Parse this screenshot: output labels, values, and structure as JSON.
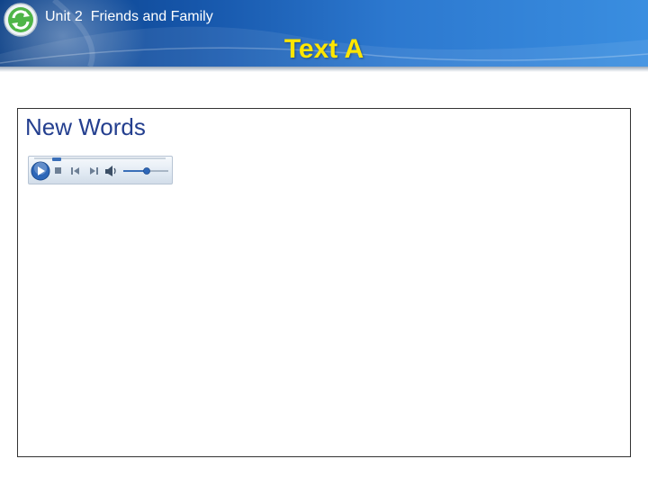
{
  "header": {
    "unit_title": "Unit 2  Friends and Family",
    "page_title": "Text A",
    "brand_colors": {
      "banner": "#1656aa",
      "title": "#ffe600"
    }
  },
  "content": {
    "section_heading": "New Words",
    "media_player": {
      "controls": [
        "play-icon",
        "stop-icon",
        "previous-icon",
        "next-icon",
        "volume-icon",
        "volume-slider"
      ]
    }
  }
}
